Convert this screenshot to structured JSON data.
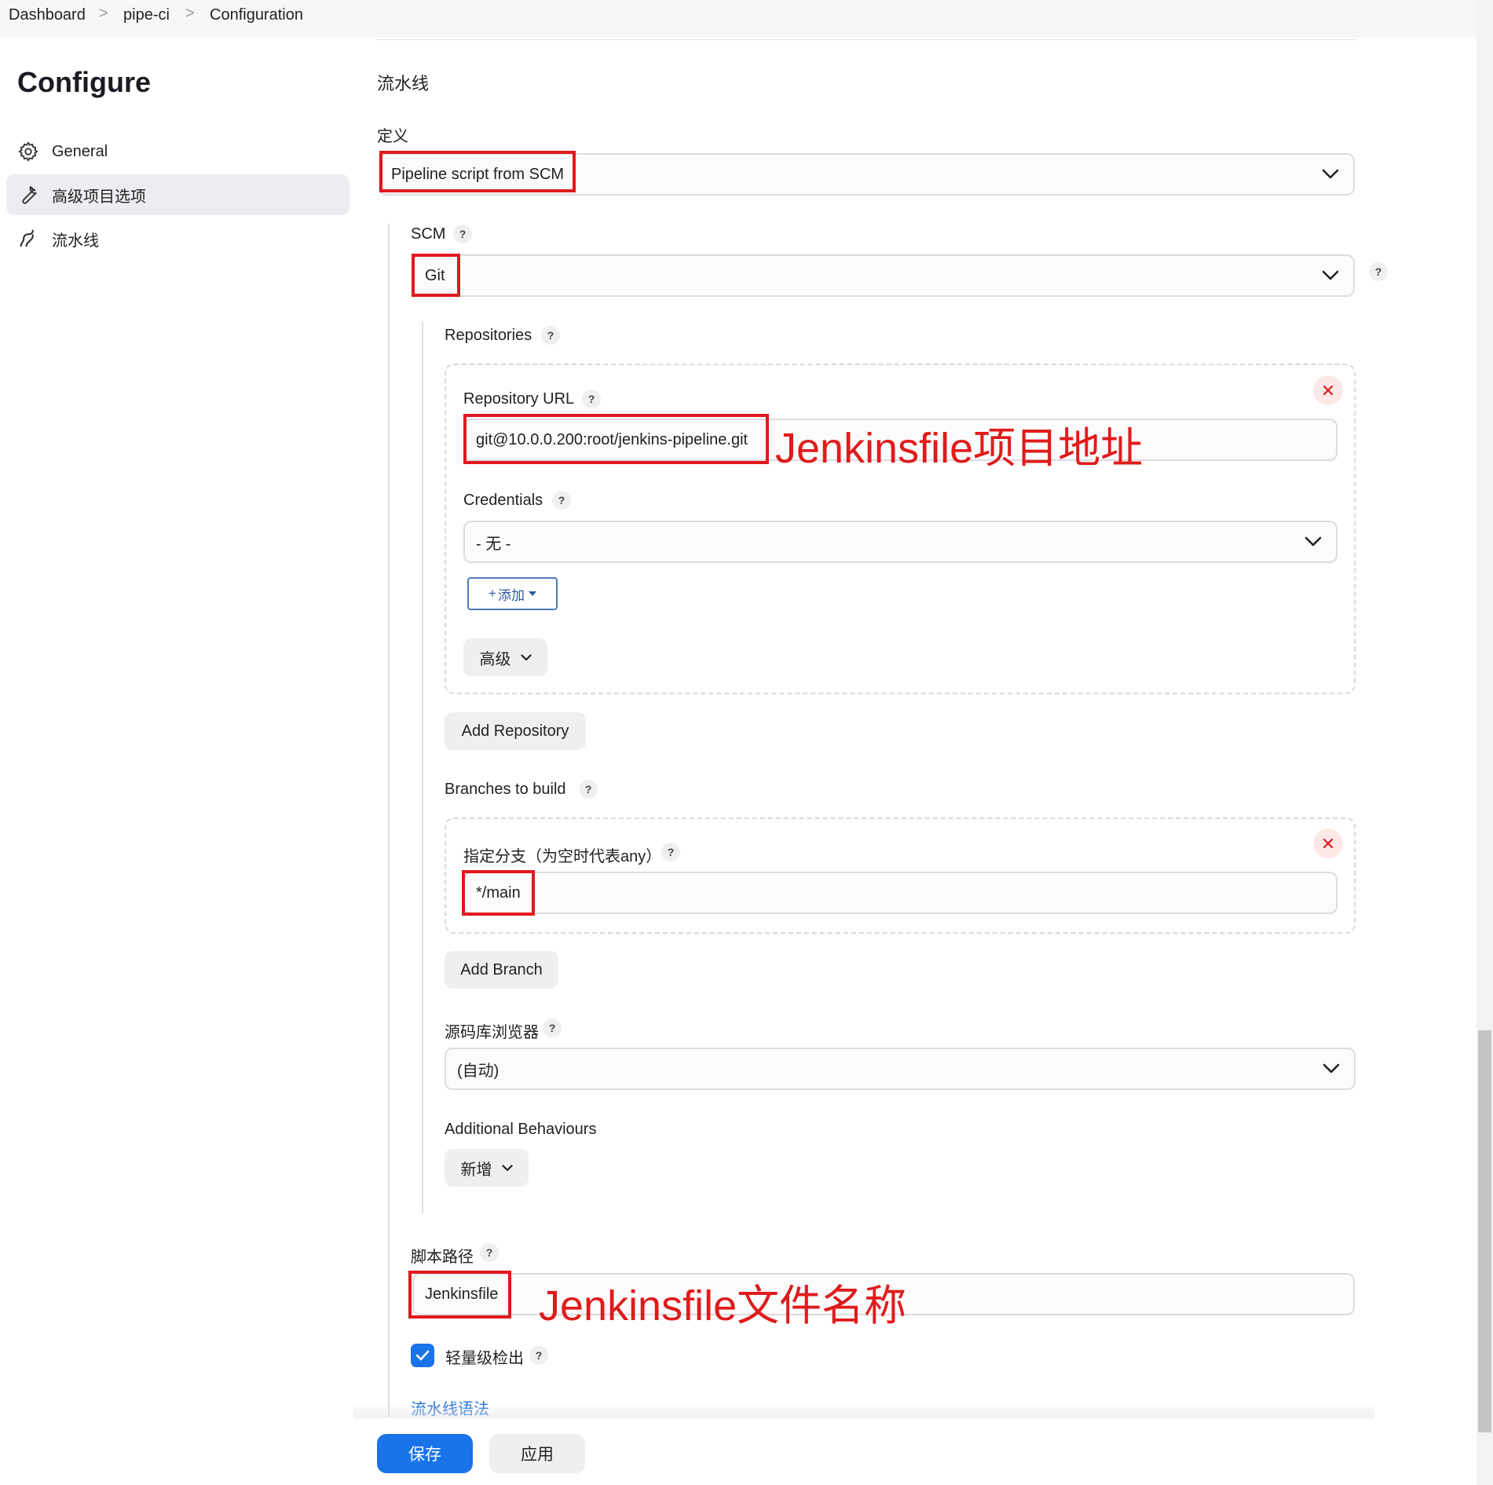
{
  "breadcrumb": {
    "item1": "Dashboard",
    "item2": "pipe-ci",
    "item3": "Configuration",
    "separator": ">"
  },
  "sidebar": {
    "title": "Configure",
    "items": [
      {
        "label": "General",
        "icon": "gear-icon"
      },
      {
        "label": "高级项目选项",
        "icon": "wrench-icon"
      },
      {
        "label": "流水线",
        "icon": "pipeline-icon"
      }
    ]
  },
  "pipeline": {
    "section_title": "流水线",
    "definition_label": "定义",
    "definition_value": "Pipeline script from SCM",
    "scm_label": "SCM",
    "scm_value": "Git",
    "repositories_label": "Repositories",
    "repo_url_label": "Repository URL",
    "repo_url_value": "git@10.0.0.200:root/jenkins-pipeline.git",
    "credentials_label": "Credentials",
    "credentials_value": "- 无 -",
    "add_label": "添加",
    "advanced_label": "高级",
    "add_repository_label": "Add Repository",
    "branches_label": "Branches to build",
    "branch_specifier_label": "指定分支（为空时代表any）",
    "branch_value": "*/main",
    "add_branch_label": "Add Branch",
    "repo_browser_label": "源码库浏览器",
    "repo_browser_value": "(自动)",
    "additional_behaviours_label": "Additional Behaviours",
    "add_behaviour_label": "新增",
    "script_path_label": "脚本路径",
    "script_path_value": "Jenkinsfile",
    "lightweight_label": "轻量级检出",
    "lightweight_checked": true,
    "syntax_link": "流水线语法"
  },
  "annotations": {
    "repo_note": "Jenkinsfile项目地址",
    "script_note": "Jenkinsfile文件名称",
    "color": "#e0181e"
  },
  "footer": {
    "save_label": "保存",
    "apply_label": "应用"
  },
  "help_glyph": "?",
  "colors": {
    "primary": "#1a73e8",
    "annotation_red": "#e0181e",
    "link": "#1a6fd6"
  }
}
